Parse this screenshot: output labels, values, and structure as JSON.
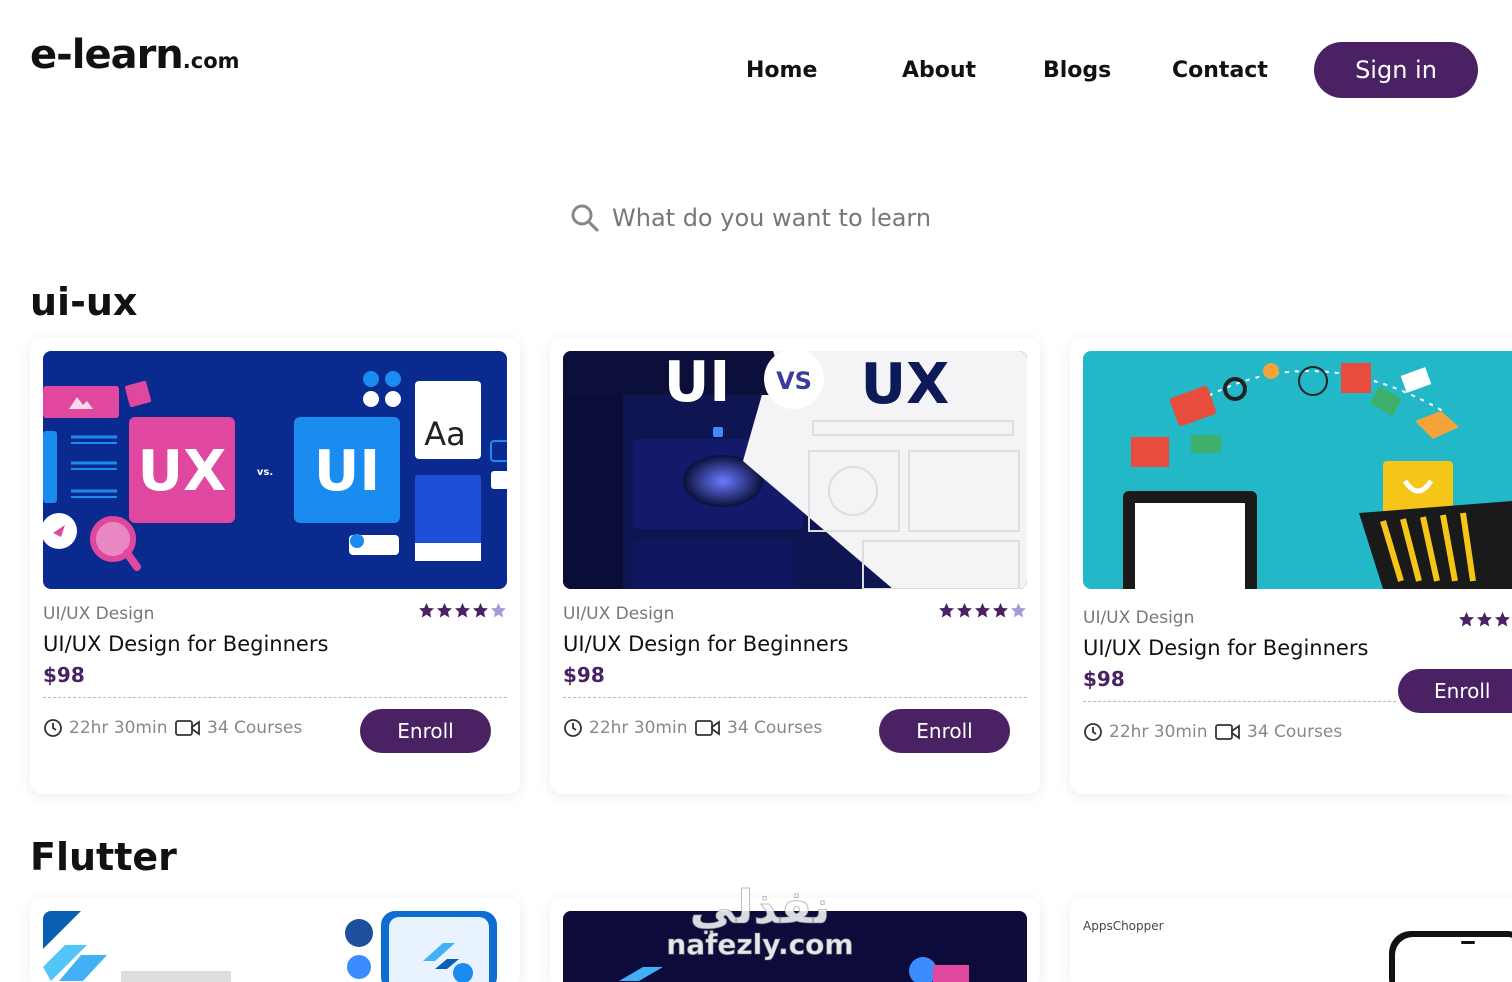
{
  "header": {
    "logo_main": "e-learn",
    "logo_tld": ".com",
    "nav": [
      "Home",
      "About",
      "Blogs",
      "Contact"
    ],
    "signin_label": "Sign in"
  },
  "search": {
    "placeholder": "What do you want to learn"
  },
  "sections": [
    {
      "title": "ui-ux",
      "cards": [
        {
          "category": "UI/UX Design",
          "title": "UI/UX Design for Beginners",
          "price": "$98",
          "duration": "22hr 30min",
          "courses": "34 Courses",
          "enroll_label": "Enroll",
          "rating": 4,
          "rating_max": 5,
          "thumb_text": [
            "UX",
            "vs.",
            "UI",
            "Aa"
          ]
        },
        {
          "category": "UI/UX Design",
          "title": "UI/UX Design for Beginners",
          "price": "$98",
          "duration": "22hr 30min",
          "courses": "34 Courses",
          "enroll_label": "Enroll",
          "rating": 4,
          "rating_max": 5,
          "thumb_text": [
            "UI",
            "VS",
            "UX"
          ]
        },
        {
          "category": "UI/UX Design",
          "title": "UI/UX Design for Beginners",
          "price": "$98",
          "duration": "22hr 30min",
          "courses": "34 Courses",
          "enroll_label": "Enroll",
          "rating": 3,
          "rating_max": 3,
          "thumb_text": []
        }
      ]
    },
    {
      "title": "Flutter",
      "cards": [
        {
          "thumb_text": []
        },
        {
          "thumb_text": []
        },
        {
          "thumb_text": [
            "AppsChopper"
          ]
        }
      ]
    }
  ],
  "watermark": {
    "arabic": "نفذلي",
    "latin": "nafezly.com"
  },
  "colors": {
    "brand": "#4a2263",
    "star": "#4a2263",
    "star_empty": "#a89ad8",
    "thumb1_bg": "#0a2a8f",
    "thumb1_ux": "#e0479e",
    "thumb1_ui": "#1a8cf0",
    "thumb3_bg": "#22b8c8"
  }
}
